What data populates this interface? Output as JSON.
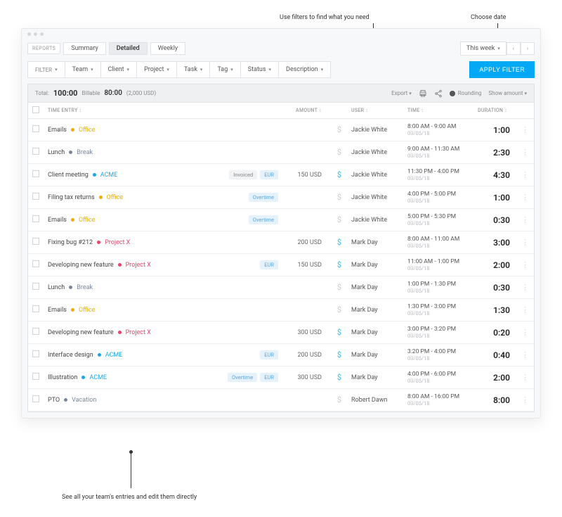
{
  "callouts": {
    "filters": "Use filters to find what you need",
    "date": "Choose date",
    "entries": "See all your team's entries and edit them directly"
  },
  "header": {
    "reports_label": "REPORTS",
    "tabs": [
      "Summary",
      "Detailed",
      "Weekly"
    ],
    "active_tab": "Detailed",
    "date_label": "This week"
  },
  "filters": {
    "label": "FILTER",
    "items": [
      "Team",
      "Client",
      "Project",
      "Task",
      "Tag",
      "Status",
      "Description"
    ],
    "apply": "APPLY FILTER"
  },
  "summary": {
    "total_label": "Total:",
    "total": "100:00",
    "billable_label": "Billable",
    "billable": "80:00",
    "usd": "(2,000 USD)",
    "export": "Export",
    "rounding": "Rounding",
    "show_amount": "Show amount"
  },
  "columns": {
    "entry": "TIME ENTRY",
    "amount": "AMOUNT",
    "user": "USER",
    "time": "TIME",
    "duration": "DURATION"
  },
  "rows": [
    {
      "desc": "Emails",
      "proj": "Office",
      "pc": "office",
      "badges": [],
      "amount": "",
      "bill": false,
      "user": "Jackie White",
      "time": "8:00 AM - 9:00 AM",
      "date": "03/05/18",
      "dur": "1:00"
    },
    {
      "desc": "Lunch",
      "proj": "Break",
      "pc": "break",
      "badges": [],
      "amount": "",
      "bill": false,
      "user": "Jackie White",
      "time": "9:00 AM - 11:30 AM",
      "date": "03/05/18",
      "dur": "2:30"
    },
    {
      "desc": "Client meeting",
      "proj": "ACME",
      "pc": "acme",
      "badges": [
        {
          "t": "Invoiced",
          "c": ""
        },
        {
          "t": "EUR",
          "c": "blue"
        }
      ],
      "amount": "150 USD",
      "bill": true,
      "user": "Jackie White",
      "time": "11:30 PM - 4:00 PM",
      "date": "03/05/18",
      "dur": "4:30"
    },
    {
      "desc": "Filing tax returns",
      "proj": "Office",
      "pc": "office",
      "badges": [
        {
          "t": "Overtime",
          "c": "blue"
        }
      ],
      "amount": "",
      "bill": false,
      "user": "Jackie White",
      "time": "4:00 PM - 5:00 PM",
      "date": "03/05/18",
      "dur": "1:00"
    },
    {
      "desc": "Emails",
      "proj": "Office",
      "pc": "office",
      "badges": [
        {
          "t": "Overtime",
          "c": "blue"
        }
      ],
      "amount": "",
      "bill": false,
      "user": "Jackie White",
      "time": "5:00 PM - 5:30 PM",
      "date": "03/05/18",
      "dur": "0:30"
    },
    {
      "desc": "Fixing bug #212",
      "proj": "Project X",
      "pc": "projectx",
      "badges": [],
      "amount": "200 USD",
      "bill": true,
      "user": "Mark Day",
      "time": "8:00 AM - 11:00 AM",
      "date": "03/05/18",
      "dur": "3:00"
    },
    {
      "desc": "Developing new feature",
      "proj": "Project X",
      "pc": "projectx",
      "badges": [
        {
          "t": "EUR",
          "c": "blue"
        }
      ],
      "amount": "150 USD",
      "bill": true,
      "user": "Mark Day",
      "time": "11:00 AM - 1:00 PM",
      "date": "03/05/18",
      "dur": "2:00"
    },
    {
      "desc": "Lunch",
      "proj": "Break",
      "pc": "break",
      "badges": [],
      "amount": "",
      "bill": false,
      "user": "Mark Day",
      "time": "1:00 PM - 1:30 PM",
      "date": "03/05/18",
      "dur": "0:30"
    },
    {
      "desc": "Emails",
      "proj": "Office",
      "pc": "office",
      "badges": [],
      "amount": "",
      "bill": false,
      "user": "Mark Day",
      "time": "1:30 PM - 3:00 PM",
      "date": "03/05/18",
      "dur": "1:30"
    },
    {
      "desc": "Developing new feature",
      "proj": "Project X",
      "pc": "projectx",
      "badges": [],
      "amount": "300 USD",
      "bill": true,
      "user": "Mark Day",
      "time": "3:00 PM - 3:20 PM",
      "date": "03/05/18",
      "dur": "0:20"
    },
    {
      "desc": "Interface design",
      "proj": "ACME",
      "pc": "acme",
      "badges": [
        {
          "t": "EUR",
          "c": "blue"
        }
      ],
      "amount": "200 USD",
      "bill": true,
      "user": "Mark Day",
      "time": "3:20 PM - 4:00 PM",
      "date": "03/05/18",
      "dur": "0:40"
    },
    {
      "desc": "Illustration",
      "proj": "ACME",
      "pc": "acme",
      "badges": [
        {
          "t": "Overtime",
          "c": "blue"
        },
        {
          "t": "EUR",
          "c": "blue"
        }
      ],
      "amount": "300 USD",
      "bill": true,
      "user": "Mark Day",
      "time": "4:00 PM - 6:00 PM",
      "date": "03/05/18",
      "dur": "2:00"
    },
    {
      "desc": "PTO",
      "proj": "Vacation",
      "pc": "vacation",
      "badges": [],
      "amount": "",
      "bill": false,
      "user": "Robert Dawn",
      "time": "8:00 AM - 16:00 PM",
      "date": "03/05/18",
      "dur": "8:00"
    }
  ]
}
